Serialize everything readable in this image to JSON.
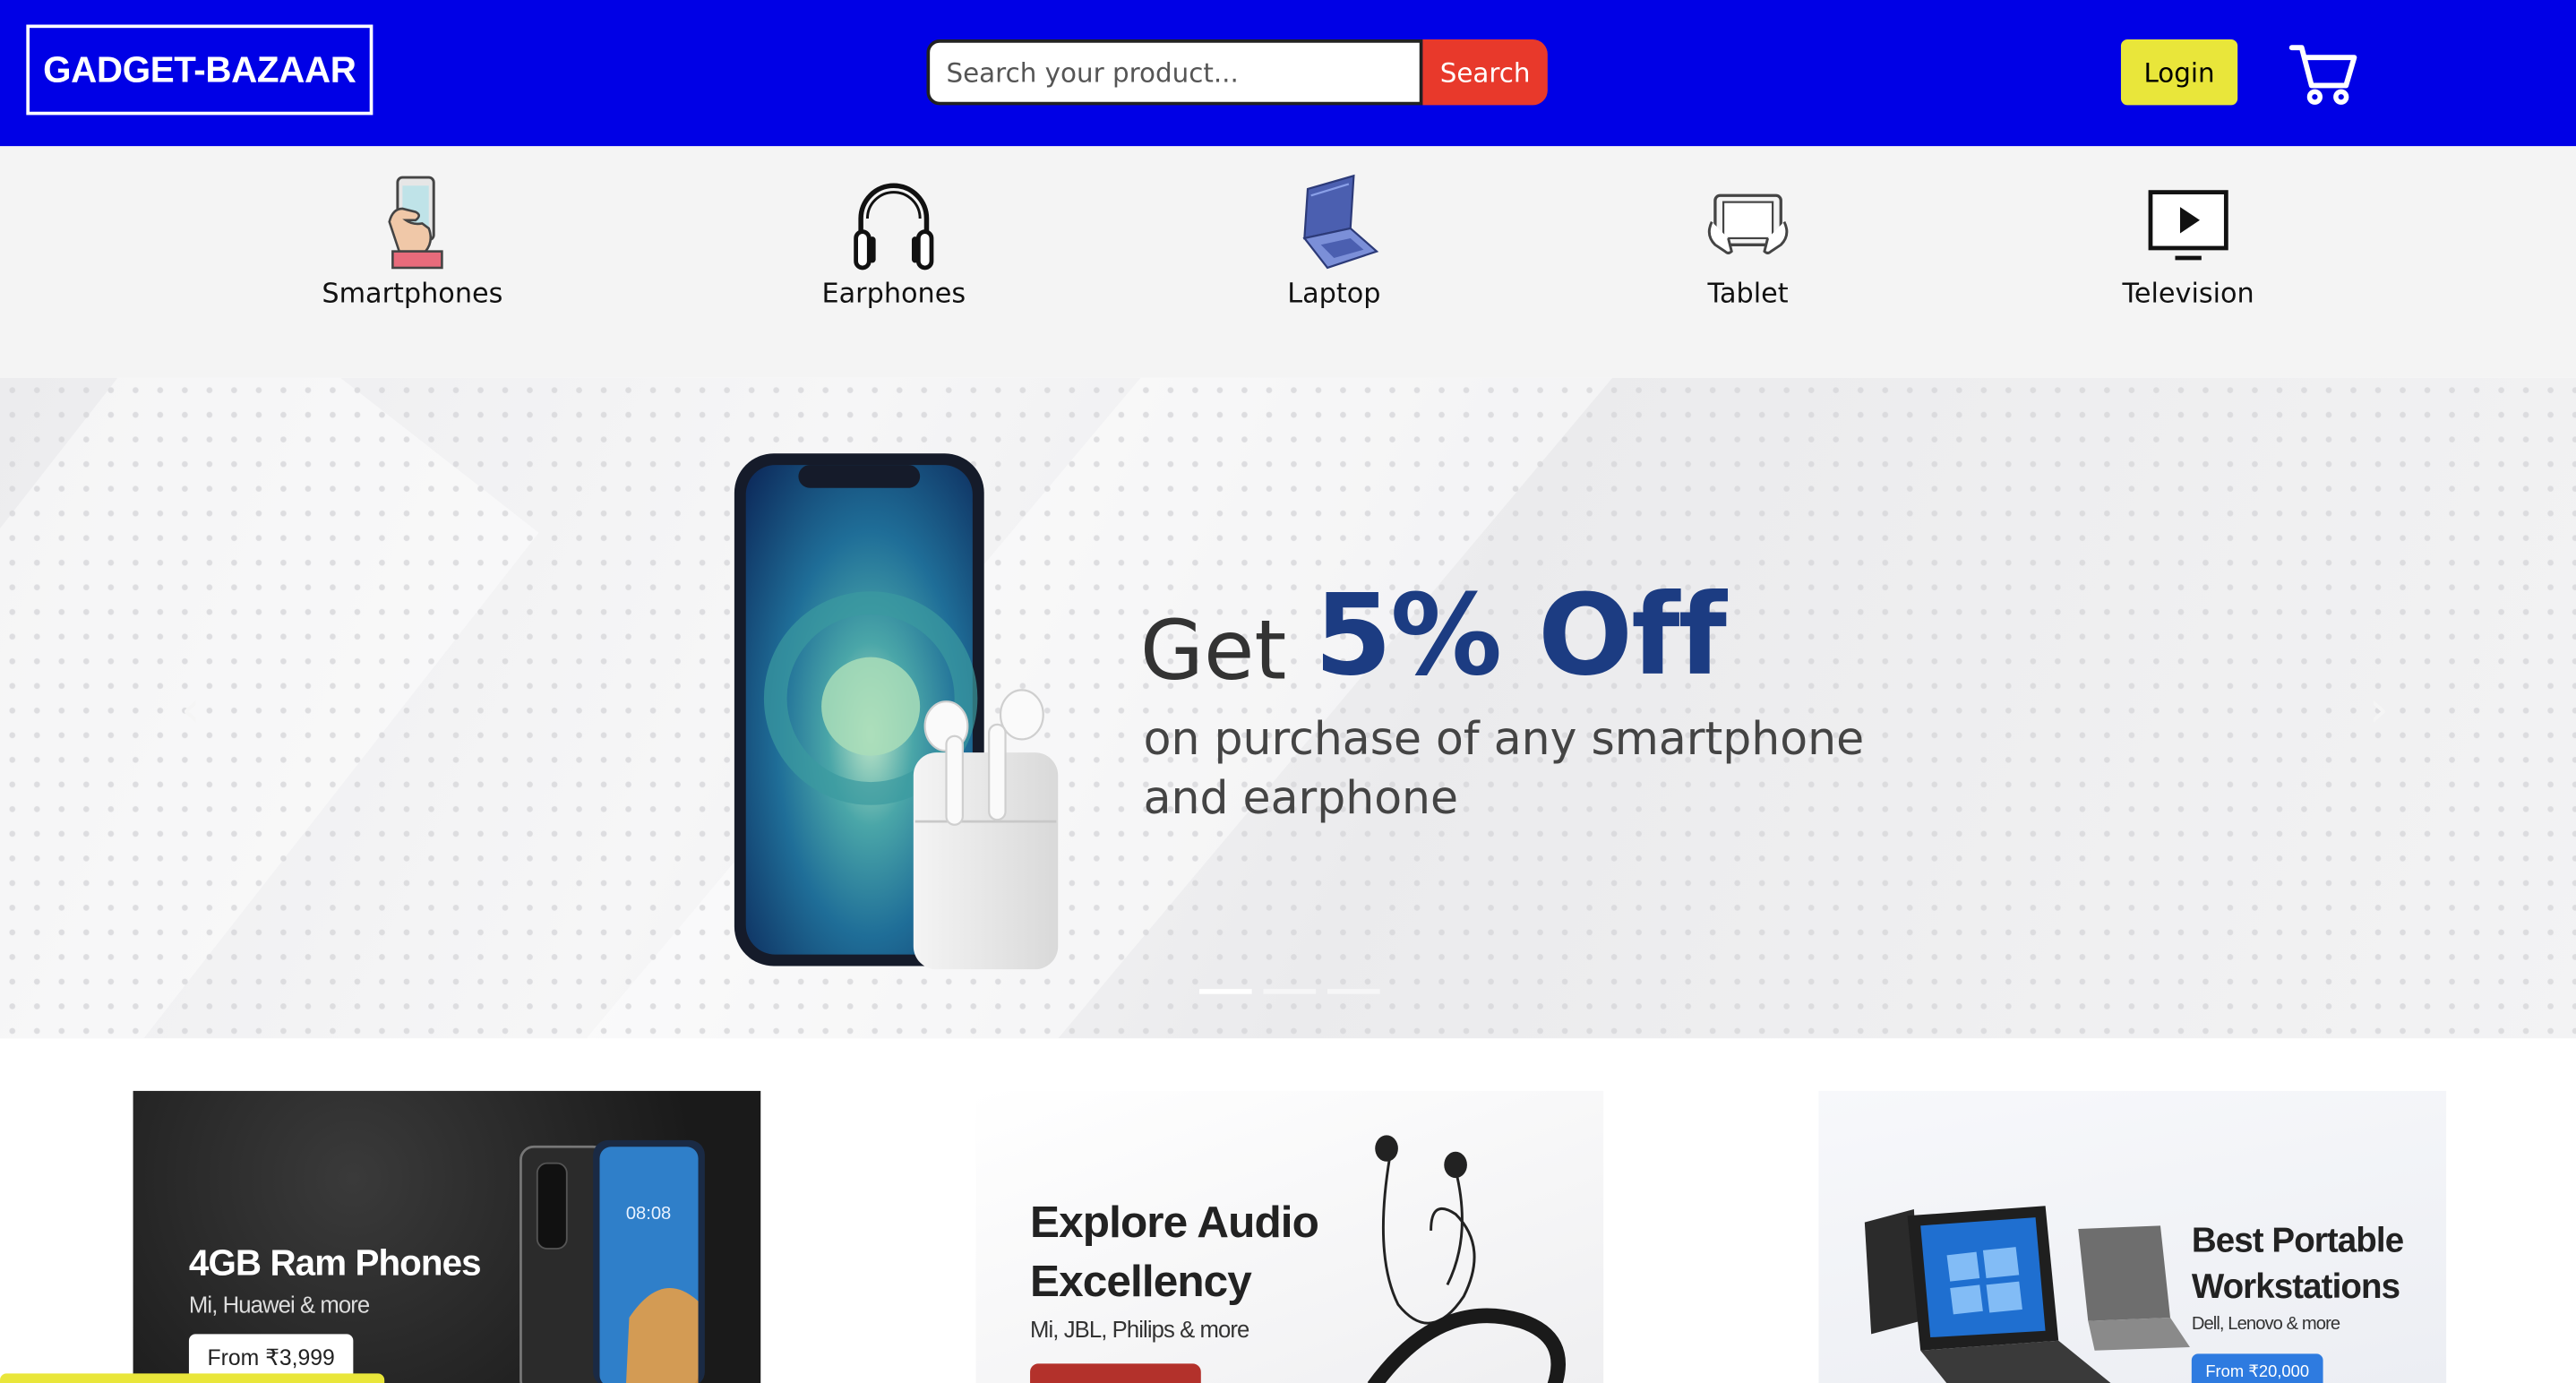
{
  "header": {
    "brand": "GADGET-BAZAAR",
    "search_placeholder": "Search your product...",
    "search_button": "Search",
    "login_button": "Login",
    "cart_icon": "cart-icon"
  },
  "categories": [
    {
      "label": "Smartphones",
      "icon": "smartphone-hand-icon"
    },
    {
      "label": "Earphones",
      "icon": "headphones-icon"
    },
    {
      "label": "Laptop",
      "icon": "laptop-icon"
    },
    {
      "label": "Tablet",
      "icon": "tablet-icon"
    },
    {
      "label": "Television",
      "icon": "television-icon"
    }
  ],
  "hero": {
    "get": "Get",
    "offer": "5% Off",
    "subtitle_line1": "on purchase of any smartphone",
    "subtitle_line2": "and earphone",
    "prev_arrow": "‹",
    "next_arrow": "›",
    "slide_count": 3,
    "active_slide": 1
  },
  "promo_cards": [
    {
      "title": "4GB Ram Phones",
      "subtitle": "Mi, Huawei & more",
      "button": "From ₹3,999"
    },
    {
      "title_line1": "Explore Audio",
      "title_line2": "Excellency",
      "subtitle": "Mi, JBL, Philips & more"
    },
    {
      "title_line1": "Best Portable",
      "title_line2": "Workstations",
      "subtitle": "Dell, Lenovo & more",
      "button": "From ₹20,000"
    }
  ],
  "colors": {
    "nav_bg": "#0000e6",
    "search_button": "#e8392b",
    "login_button": "#e9e63a",
    "offer_text": "#1c3c82"
  }
}
